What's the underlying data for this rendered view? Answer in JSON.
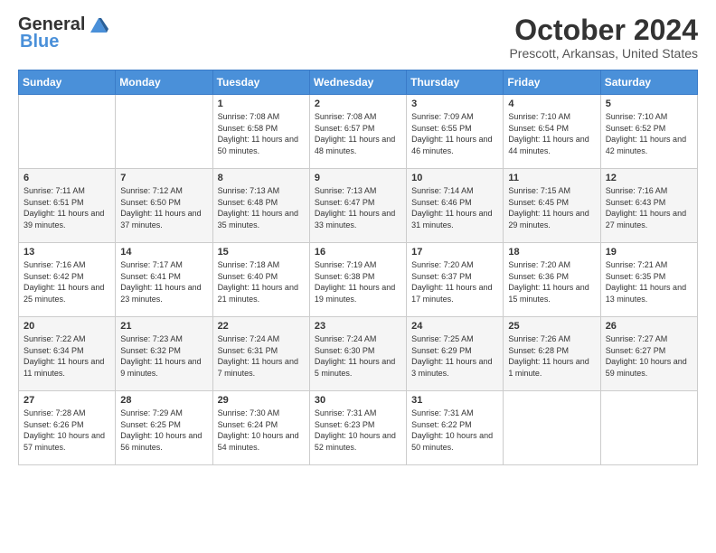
{
  "header": {
    "logo_general": "General",
    "logo_blue": "Blue",
    "month_title": "October 2024",
    "location": "Prescott, Arkansas, United States"
  },
  "days_of_week": [
    "Sunday",
    "Monday",
    "Tuesday",
    "Wednesday",
    "Thursday",
    "Friday",
    "Saturday"
  ],
  "weeks": [
    [
      {
        "day": "",
        "info": ""
      },
      {
        "day": "",
        "info": ""
      },
      {
        "day": "1",
        "info": "Sunrise: 7:08 AM\nSunset: 6:58 PM\nDaylight: 11 hours and 50 minutes."
      },
      {
        "day": "2",
        "info": "Sunrise: 7:08 AM\nSunset: 6:57 PM\nDaylight: 11 hours and 48 minutes."
      },
      {
        "day": "3",
        "info": "Sunrise: 7:09 AM\nSunset: 6:55 PM\nDaylight: 11 hours and 46 minutes."
      },
      {
        "day": "4",
        "info": "Sunrise: 7:10 AM\nSunset: 6:54 PM\nDaylight: 11 hours and 44 minutes."
      },
      {
        "day": "5",
        "info": "Sunrise: 7:10 AM\nSunset: 6:52 PM\nDaylight: 11 hours and 42 minutes."
      }
    ],
    [
      {
        "day": "6",
        "info": "Sunrise: 7:11 AM\nSunset: 6:51 PM\nDaylight: 11 hours and 39 minutes."
      },
      {
        "day": "7",
        "info": "Sunrise: 7:12 AM\nSunset: 6:50 PM\nDaylight: 11 hours and 37 minutes."
      },
      {
        "day": "8",
        "info": "Sunrise: 7:13 AM\nSunset: 6:48 PM\nDaylight: 11 hours and 35 minutes."
      },
      {
        "day": "9",
        "info": "Sunrise: 7:13 AM\nSunset: 6:47 PM\nDaylight: 11 hours and 33 minutes."
      },
      {
        "day": "10",
        "info": "Sunrise: 7:14 AM\nSunset: 6:46 PM\nDaylight: 11 hours and 31 minutes."
      },
      {
        "day": "11",
        "info": "Sunrise: 7:15 AM\nSunset: 6:45 PM\nDaylight: 11 hours and 29 minutes."
      },
      {
        "day": "12",
        "info": "Sunrise: 7:16 AM\nSunset: 6:43 PM\nDaylight: 11 hours and 27 minutes."
      }
    ],
    [
      {
        "day": "13",
        "info": "Sunrise: 7:16 AM\nSunset: 6:42 PM\nDaylight: 11 hours and 25 minutes."
      },
      {
        "day": "14",
        "info": "Sunrise: 7:17 AM\nSunset: 6:41 PM\nDaylight: 11 hours and 23 minutes."
      },
      {
        "day": "15",
        "info": "Sunrise: 7:18 AM\nSunset: 6:40 PM\nDaylight: 11 hours and 21 minutes."
      },
      {
        "day": "16",
        "info": "Sunrise: 7:19 AM\nSunset: 6:38 PM\nDaylight: 11 hours and 19 minutes."
      },
      {
        "day": "17",
        "info": "Sunrise: 7:20 AM\nSunset: 6:37 PM\nDaylight: 11 hours and 17 minutes."
      },
      {
        "day": "18",
        "info": "Sunrise: 7:20 AM\nSunset: 6:36 PM\nDaylight: 11 hours and 15 minutes."
      },
      {
        "day": "19",
        "info": "Sunrise: 7:21 AM\nSunset: 6:35 PM\nDaylight: 11 hours and 13 minutes."
      }
    ],
    [
      {
        "day": "20",
        "info": "Sunrise: 7:22 AM\nSunset: 6:34 PM\nDaylight: 11 hours and 11 minutes."
      },
      {
        "day": "21",
        "info": "Sunrise: 7:23 AM\nSunset: 6:32 PM\nDaylight: 11 hours and 9 minutes."
      },
      {
        "day": "22",
        "info": "Sunrise: 7:24 AM\nSunset: 6:31 PM\nDaylight: 11 hours and 7 minutes."
      },
      {
        "day": "23",
        "info": "Sunrise: 7:24 AM\nSunset: 6:30 PM\nDaylight: 11 hours and 5 minutes."
      },
      {
        "day": "24",
        "info": "Sunrise: 7:25 AM\nSunset: 6:29 PM\nDaylight: 11 hours and 3 minutes."
      },
      {
        "day": "25",
        "info": "Sunrise: 7:26 AM\nSunset: 6:28 PM\nDaylight: 11 hours and 1 minute."
      },
      {
        "day": "26",
        "info": "Sunrise: 7:27 AM\nSunset: 6:27 PM\nDaylight: 10 hours and 59 minutes."
      }
    ],
    [
      {
        "day": "27",
        "info": "Sunrise: 7:28 AM\nSunset: 6:26 PM\nDaylight: 10 hours and 57 minutes."
      },
      {
        "day": "28",
        "info": "Sunrise: 7:29 AM\nSunset: 6:25 PM\nDaylight: 10 hours and 56 minutes."
      },
      {
        "day": "29",
        "info": "Sunrise: 7:30 AM\nSunset: 6:24 PM\nDaylight: 10 hours and 54 minutes."
      },
      {
        "day": "30",
        "info": "Sunrise: 7:31 AM\nSunset: 6:23 PM\nDaylight: 10 hours and 52 minutes."
      },
      {
        "day": "31",
        "info": "Sunrise: 7:31 AM\nSunset: 6:22 PM\nDaylight: 10 hours and 50 minutes."
      },
      {
        "day": "",
        "info": ""
      },
      {
        "day": "",
        "info": ""
      }
    ]
  ]
}
